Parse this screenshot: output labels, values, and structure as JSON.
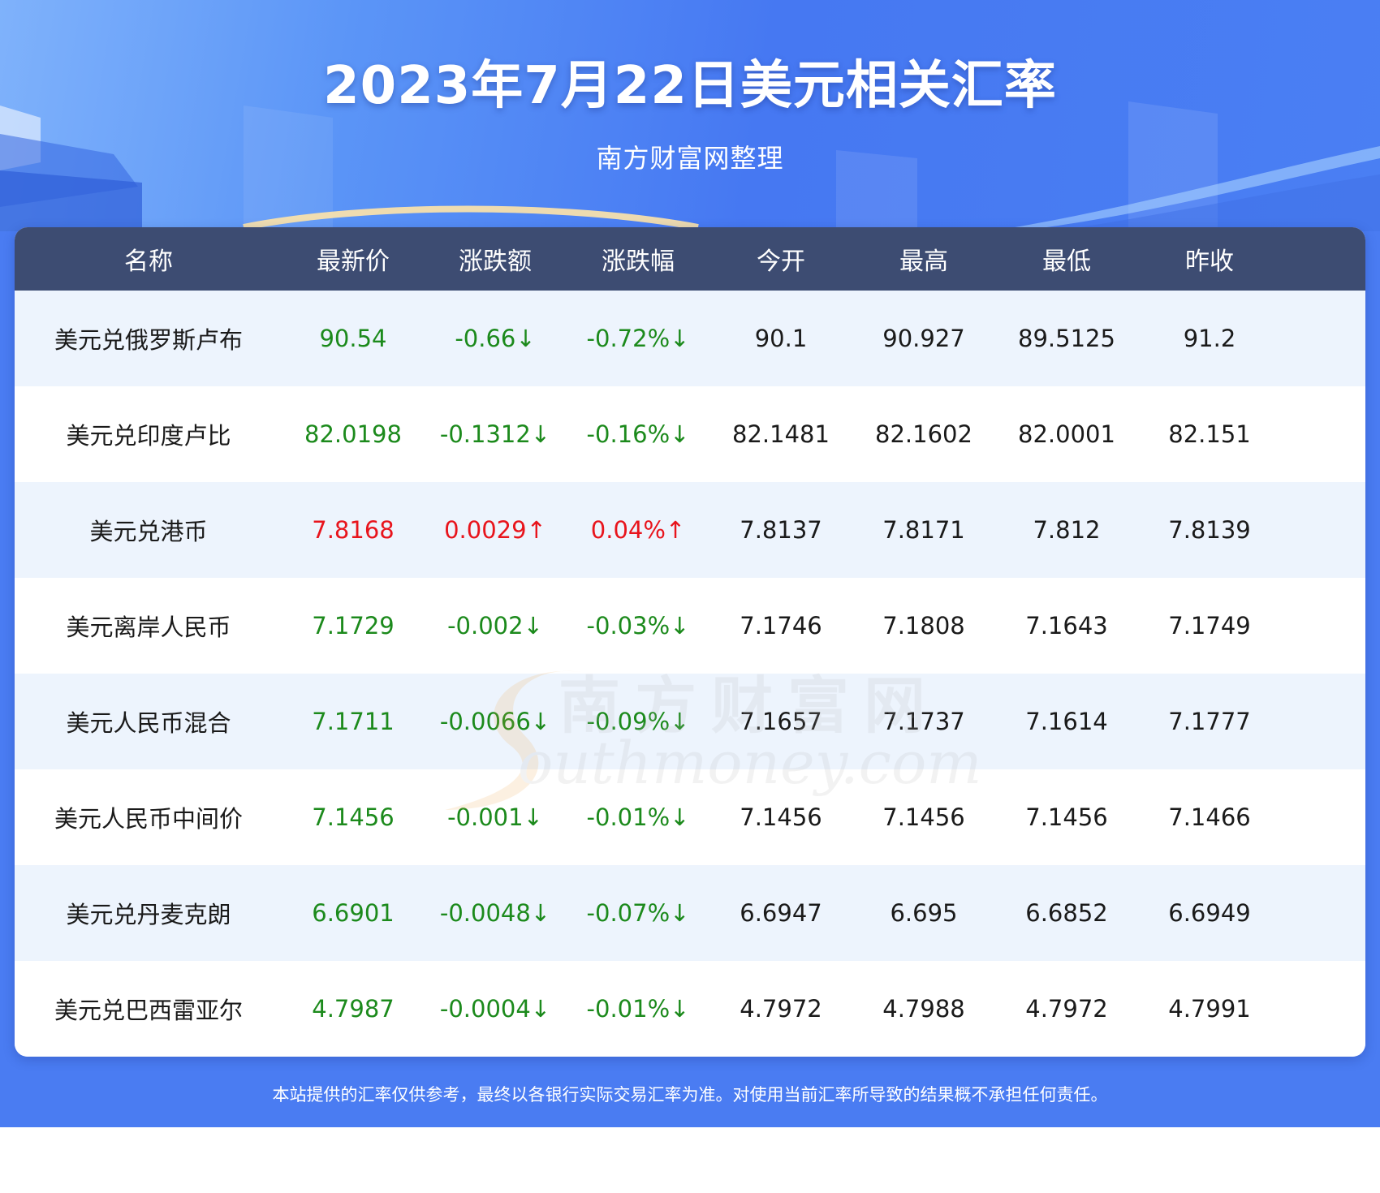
{
  "header": {
    "title": "2023年7月22日美元相关汇率",
    "subtitle": "南方财富网整理"
  },
  "table": {
    "columns": [
      "名称",
      "最新价",
      "涨跌额",
      "涨跌幅",
      "今开",
      "最高",
      "最低",
      "昨收"
    ],
    "rows": [
      {
        "name": "美元兑俄罗斯卢布",
        "latest": "90.54",
        "change": "-0.66↓",
        "pct": "-0.72%↓",
        "open": "90.1",
        "high": "90.927",
        "low": "89.5125",
        "prev": "91.2",
        "trend": "down"
      },
      {
        "name": "美元兑印度卢比",
        "latest": "82.0198",
        "change": "-0.1312↓",
        "pct": "-0.16%↓",
        "open": "82.1481",
        "high": "82.1602",
        "low": "82.0001",
        "prev": "82.151",
        "trend": "down"
      },
      {
        "name": "美元兑港币",
        "latest": "7.8168",
        "change": "0.0029↑",
        "pct": "0.04%↑",
        "open": "7.8137",
        "high": "7.8171",
        "low": "7.812",
        "prev": "7.8139",
        "trend": "up"
      },
      {
        "name": "美元离岸人民币",
        "latest": "7.1729",
        "change": "-0.002↓",
        "pct": "-0.03%↓",
        "open": "7.1746",
        "high": "7.1808",
        "low": "7.1643",
        "prev": "7.1749",
        "trend": "down"
      },
      {
        "name": "美元人民币混合",
        "latest": "7.1711",
        "change": "-0.0066↓",
        "pct": "-0.09%↓",
        "open": "7.1657",
        "high": "7.1737",
        "low": "7.1614",
        "prev": "7.1777",
        "trend": "down"
      },
      {
        "name": "美元人民币中间价",
        "latest": "7.1456",
        "change": "-0.001↓",
        "pct": "-0.01%↓",
        "open": "7.1456",
        "high": "7.1456",
        "low": "7.1456",
        "prev": "7.1466",
        "trend": "down"
      },
      {
        "name": "美元兑丹麦克朗",
        "latest": "6.6901",
        "change": "-0.0048↓",
        "pct": "-0.07%↓",
        "open": "6.6947",
        "high": "6.695",
        "low": "6.6852",
        "prev": "6.6949",
        "trend": "down"
      },
      {
        "name": "美元兑巴西雷亚尔",
        "latest": "4.7987",
        "change": "-0.0004↓",
        "pct": "-0.01%↓",
        "open": "4.7972",
        "high": "4.7988",
        "low": "4.7972",
        "prev": "4.7991",
        "trend": "down"
      }
    ]
  },
  "watermark": {
    "cn": "南方财富网",
    "en": "outhmoney.com"
  },
  "footer": {
    "disclaimer": "本站提供的汇率仅供参考，最终以各银行实际交易汇率为准。对使用当前汇率所导致的结果概不承担任何责任。"
  },
  "colors": {
    "background_blue": "#4a7cf2",
    "header_row": "#3d4c72",
    "row_alt": "#edf4fd",
    "down": "#1c8a1c",
    "up": "#e8141c"
  }
}
